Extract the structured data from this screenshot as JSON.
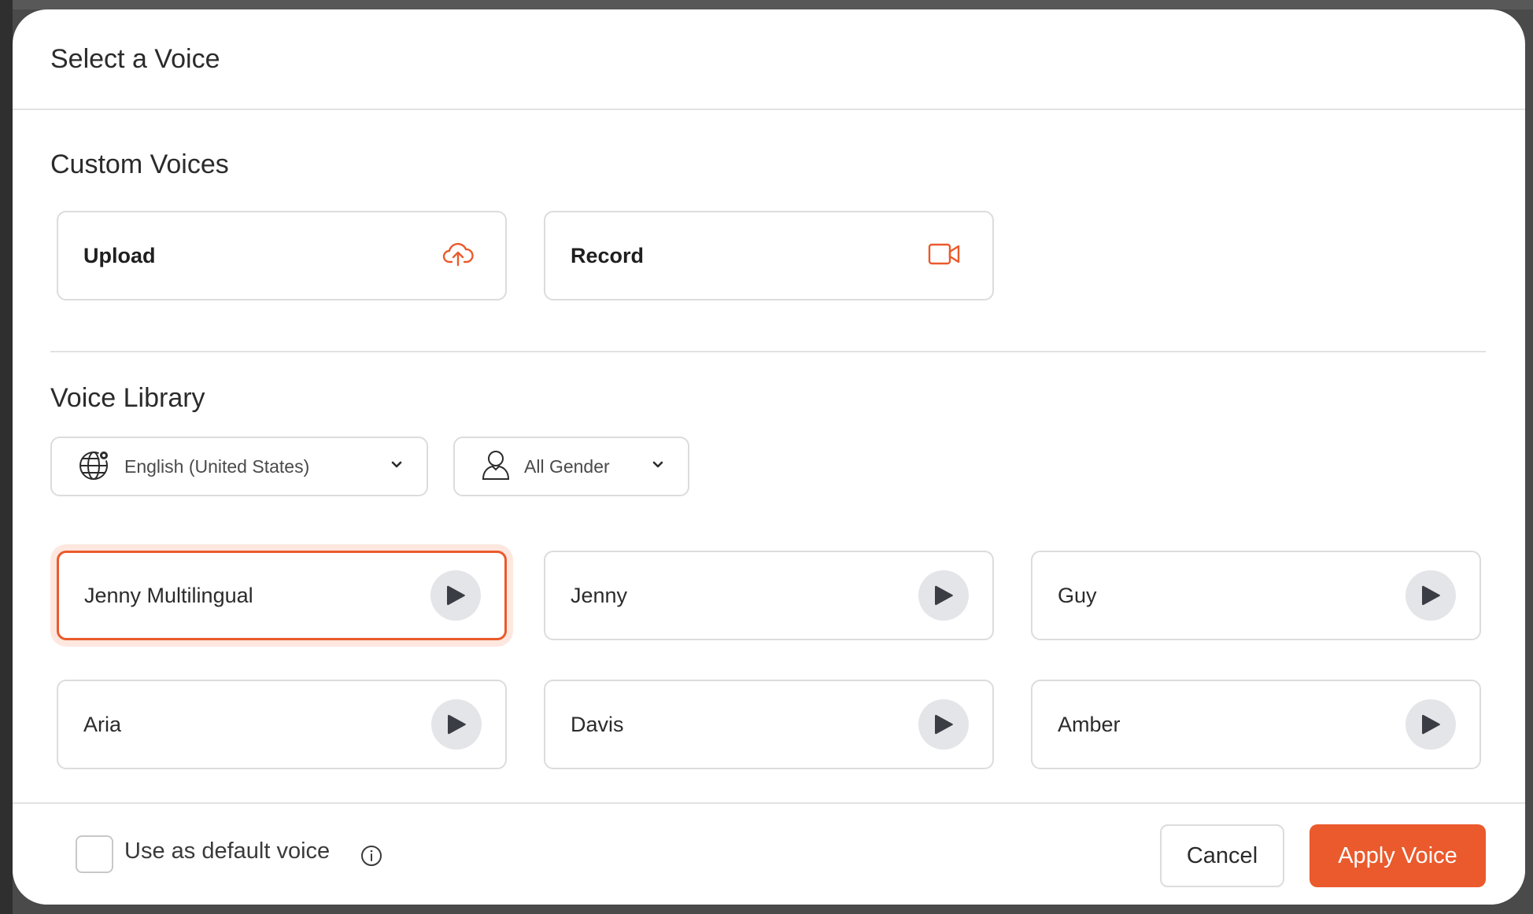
{
  "modal": {
    "title": "Select a Voice"
  },
  "custom_voices": {
    "title": "Custom Voices",
    "upload_label": "Upload",
    "upload_icon": "cloud-upload-icon",
    "record_label": "Record",
    "record_icon": "video-camera-icon"
  },
  "voice_library": {
    "title": "Voice Library",
    "language_filter": {
      "value": "English (United States)",
      "icon": "globe-icon"
    },
    "gender_filter": {
      "value": "All Gender",
      "icon": "person-icon"
    },
    "voices": [
      {
        "name": "Jenny Multilingual",
        "selected": true
      },
      {
        "name": "Jenny",
        "selected": false
      },
      {
        "name": "Guy",
        "selected": false
      },
      {
        "name": "Aria",
        "selected": false
      },
      {
        "name": "Davis",
        "selected": false
      },
      {
        "name": "Amber",
        "selected": false
      }
    ]
  },
  "footer": {
    "default_voice_label": "Use as default voice",
    "cancel_label": "Cancel",
    "apply_label": "Apply Voice"
  },
  "colors": {
    "accent": "#ea5a2c",
    "accent_soft": "#fde7df",
    "border": "#dcdcdc",
    "play_bg": "#e4e5e8"
  }
}
